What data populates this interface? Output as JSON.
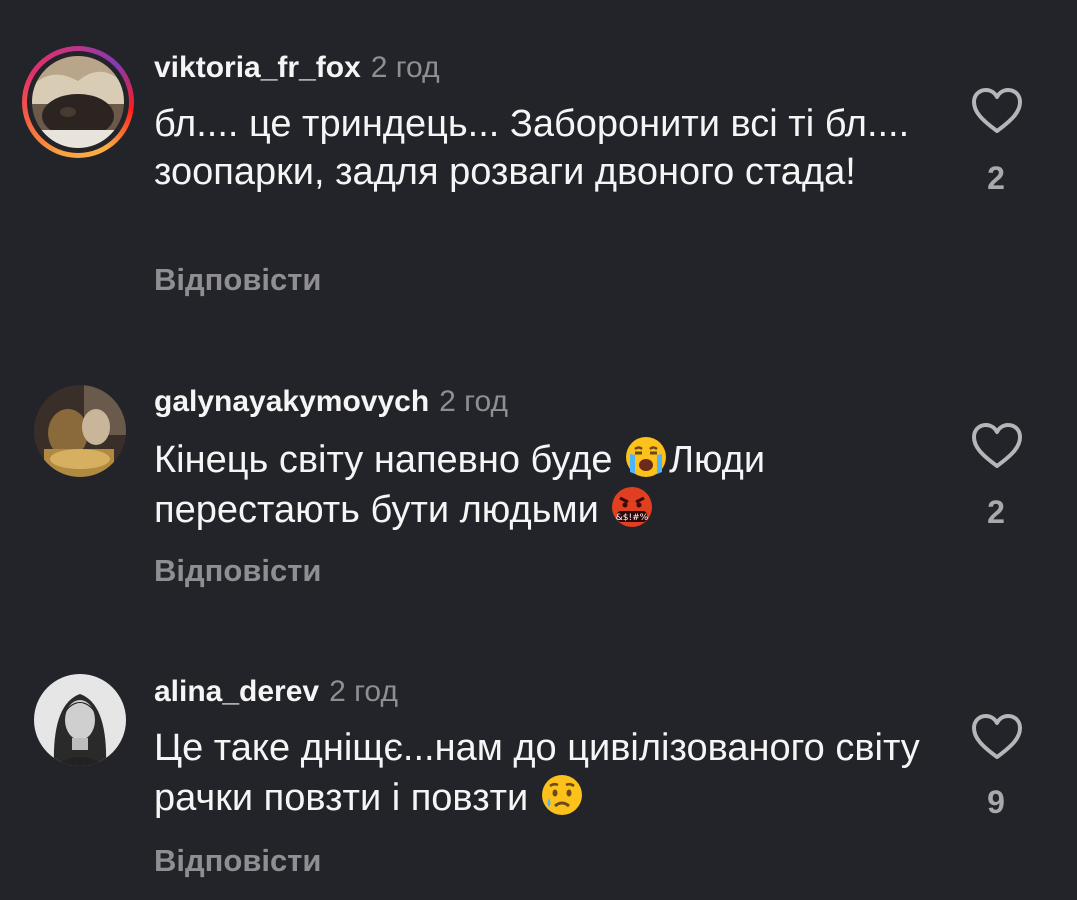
{
  "comments": [
    {
      "username": "viktoria_fr_fox",
      "time": "2 год",
      "text": "бл.... це триндець... Заборонити всі ті бл.... зоопарки, задля розваги двоного стада!",
      "reply_label": "Відповісти",
      "likes": "2",
      "has_story_ring": true
    },
    {
      "username": "galynayakymovych",
      "time": "2 год",
      "text_part1": "Кінець світу напевно буде",
      "text_part2": "Люди перестають бути людьми",
      "emoji1": "loudly-crying-face",
      "emoji2": "face-with-symbols-on-mouth",
      "reply_label": "Відповісти",
      "likes": "2",
      "has_story_ring": false
    },
    {
      "username": "alina_derev",
      "time": "2 год",
      "text": "Це таке дніщє...нам до цивілізованого світу рачки повзти і повзти",
      "emoji1": "crying-face",
      "reply_label": "Відповісти",
      "likes": "9",
      "has_story_ring": false
    }
  ],
  "colors": {
    "background": "#222429",
    "text": "#f5f5f5",
    "secondary": "#8e8e93"
  }
}
